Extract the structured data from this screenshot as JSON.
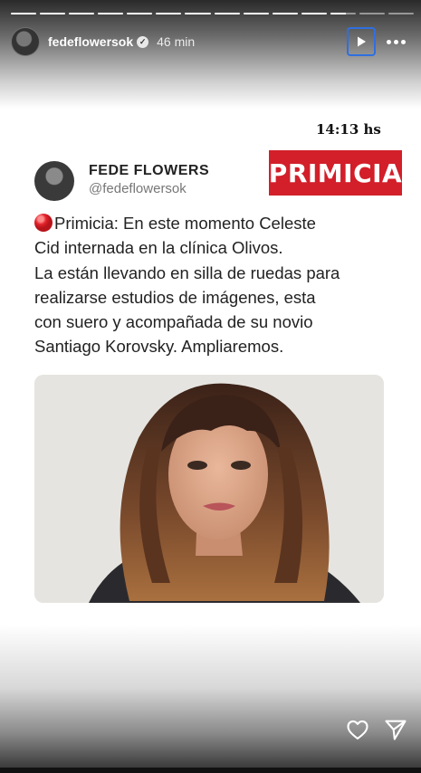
{
  "story": {
    "progress_segments_total": 14,
    "progress_segments_done": 11,
    "progress_current_fraction": 0.6,
    "username": "fedeflowersok",
    "posted_ago": "46 min",
    "icons": {
      "verified": "verified-badge-icon",
      "play": "play-icon",
      "more": "more-icon",
      "like": "heart-icon",
      "share": "send-icon"
    }
  },
  "post": {
    "timestamp": "14:13 hs",
    "author_name": "FEDE FLOWERS",
    "author_handle": "@fedeflowersok",
    "badge_label": "PRIMICIA",
    "badge_color": "#d21f2a",
    "text_lines": [
      "Primicia: En este momento Celeste",
      "Cid internada en la clínica Olivos.",
      "La están llevando en silla de ruedas para",
      "realizarse estudios de imágenes, esta",
      "con suero y acompañada de su novio",
      "Santiago Korovsky. Ampliaremos."
    ],
    "photo_subject": "portrait-photo"
  }
}
